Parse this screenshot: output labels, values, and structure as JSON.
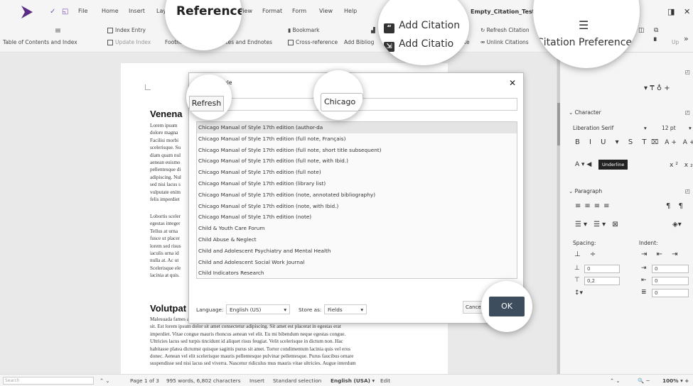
{
  "menubar": {
    "quick_access": [
      "✓",
      "◱"
    ],
    "items": [
      "File",
      "Home",
      "Insert",
      "Layo",
      "View",
      "Format",
      "Form",
      "View",
      "Help"
    ],
    "active_tab": "References",
    "doc_title": "Empty_Citation_Test.odt",
    "window_buttons": [
      "◨",
      "✕"
    ]
  },
  "ribbon": {
    "toc": "Table of Contents and Index",
    "index_entry": "Index Entry",
    "update_index": "Update Index",
    "footnote": "Footnote",
    "te": "te",
    "footnotes_endnotes": "Footnotes and Endnotes",
    "bookmark": "Bookmark",
    "cross_reference": "Cross-reference",
    "add_bibliog": "Add Bibliog",
    "te2": "te",
    "refresh_citation": "Refresh Citation",
    "unlink_citations": "Unlink Citations",
    "up": "Up",
    "more": "»"
  },
  "callouts": {
    "references": "References",
    "add_citation_1": "Add Citation",
    "add_citation_2": "Add Citatio",
    "citation_preferences": "Citation Preferences",
    "refresh": "Refresh",
    "chicago": "Chicago",
    "ok": "OK"
  },
  "document": {
    "heading1": "Venena",
    "para1": [
      "Lorem ipsum",
      "dolore magna",
      "Facilisi morbi",
      "scelerisque. Su",
      "diam quam nul",
      "aenean euismo",
      "pellentesque di",
      "adipiscing. Nul",
      "sed nisi lacus s",
      "vulputate enim",
      "felis imperdiet"
    ],
    "para2": [
      "Lobortis sceler",
      "egestas integer",
      "Tellus at urna",
      "fusce ut placer",
      "lorem sed risus",
      "iaculis urna id",
      "nulla at. Ac ut",
      "Scelerisque ele",
      "lacinia at quis."
    ],
    "heading2": "Volutpat",
    "para3": [
      "Malesuada fames ac turpis egestas sed tempus urna et pharetra. Libero nunc consequat interdum varius",
      "sit. Est lorem ipsum dolor sit amet consectetur adipiscing. Sit amet est placerat in egestas erat",
      "imperdiet. Vitae congue mauris rhoncus aenean vel elit. Eu mi bibendum neque egestas congue.",
      "Ultricies lacus sed turpis tincidunt id aliquet risus feugiat. Velit scelerisque in dictum non. Hac",
      "habitasse platea dictumst quisque sagittis purus sit amet. Tortor condimentum lacinia quis vel eros",
      "donec. Aenean vel elit scelerisque mauris pellentesque pulvinar pellentesque. Purus faucibus ornare",
      "suspendisse sed nisi lacus sed viverra. Nascetur ridiculus mus mauris vitae ultricies. Augue interdum"
    ]
  },
  "dialog": {
    "title": "Citation Style",
    "close": "✕",
    "styles": [
      "Chicago Manual of Style 17th edition (author-da",
      "Chicago Manual of Style 17th edition (full note, Français)",
      "Chicago Manual of Style 17th edition (full note, short title subsequent)",
      "Chicago Manual of Style 17th edition (full note, with Ibid.)",
      "Chicago Manual of Style 17th edition (full note)",
      "Chicago Manual of Style 17th edition (library list)",
      "Chicago Manual of Style 17th edition (note, annotated bibliography)",
      "Chicago Manual of Style 17th edition (note, with Ibid.)",
      "Chicago Manual of Style 17th edition (note)",
      "Child & Youth Care Forum",
      "Child Abuse & Neglect",
      "Child and Adolescent Psychiatry and Mental Health",
      "Child and Adolescent Social Work Journal",
      "Child Indicators Research"
    ],
    "language_label": "Language:",
    "language_value": "English (US)",
    "store_label": "Store as:",
    "store_value": "Fields",
    "cancel": "Cance"
  },
  "sidebar": {
    "character": "Character",
    "font_name": "Liberation Serif",
    "font_size": "12 pt",
    "tooltip": "Underline",
    "paragraph": "Paragraph",
    "spacing": "Spacing:",
    "indent": "Indent:",
    "spacing_values": [
      "0",
      "0,2"
    ],
    "indent_values": [
      "0",
      "0",
      "0"
    ]
  },
  "statusbar": {
    "search_placeholder": "Search",
    "page": "Page 1 of 3",
    "words": "995 words, 6,802 characters",
    "mode": "Insert",
    "selection": "Standard selection",
    "language": "English (USA)",
    "edit": "Edit",
    "zoom": "100%"
  }
}
